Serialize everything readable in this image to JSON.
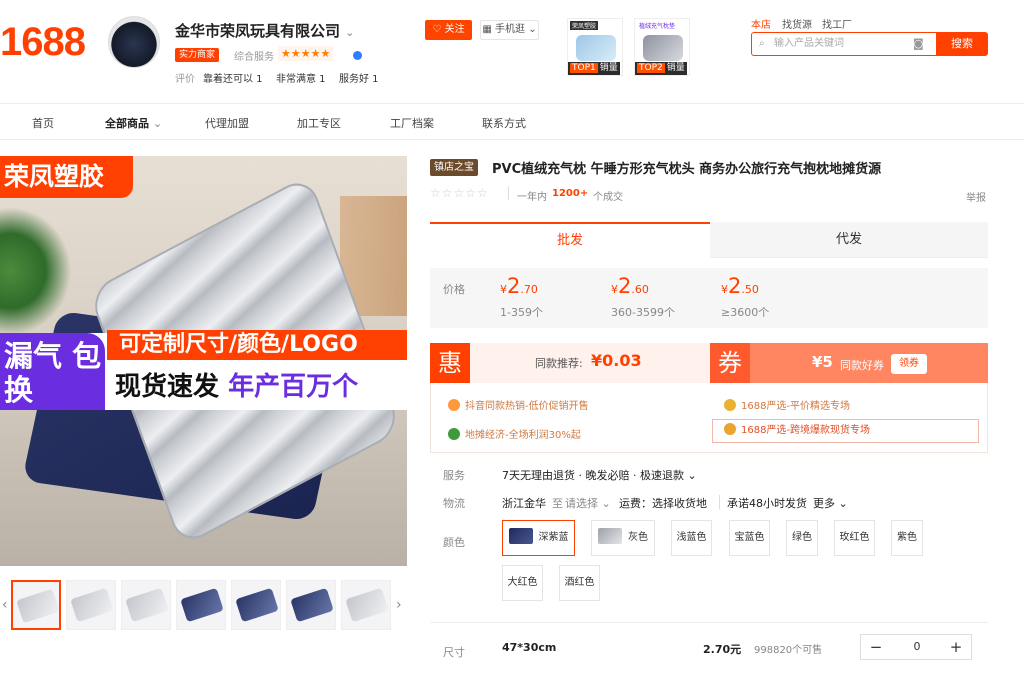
{
  "brand": {
    "logo": "1688"
  },
  "store": {
    "name": "金华市荣凤玩具有限公司",
    "strength_badge": "实力商家",
    "service_label": "综合服务",
    "stars": "★★★★★",
    "eval_label": "评价",
    "evals": [
      "靠着还可以 1",
      "非常满意 1",
      "服务好 1"
    ],
    "follow": "关注",
    "mobile": "手机逛"
  },
  "top_products": [
    {
      "badge": "TOP1",
      "label": "销量",
      "tag": "荣凤塑胶"
    },
    {
      "badge": "TOP2",
      "label": "销量",
      "tag": "植绒充气枕垫"
    }
  ],
  "top_nav": [
    "本店",
    "找货源",
    "找工厂"
  ],
  "search": {
    "placeholder": "输入产品关键词",
    "button": "搜索"
  },
  "nav": [
    "首页",
    "全部商品",
    "代理加盟",
    "加工专区",
    "工厂档案",
    "联系方式"
  ],
  "main_image": {
    "brand": "荣凤塑胶",
    "leak": "漏气 包换",
    "custom": "可定制尺寸/颜色/LOGO",
    "fast": "现货速发",
    "annual": "年产百万个"
  },
  "product": {
    "tag": "镇店之宝",
    "title": "PVC植绒充气枕 午睡方形充气枕头 商务办公旅行充气抱枕地摊货源",
    "stars": "☆☆☆☆☆",
    "deal_label": "一年内",
    "deal_count": "1200+",
    "deal_unit": "个成交",
    "report": "举报"
  },
  "tabs": [
    "批发",
    "代发"
  ],
  "prices": {
    "label": "价格",
    "tiers": [
      {
        "yen": "¥",
        "int": "2",
        "dec": ".70",
        "range": "1-359个"
      },
      {
        "yen": "¥",
        "int": "2",
        "dec": ".60",
        "range": "360-3599个"
      },
      {
        "yen": "¥",
        "int": "2",
        "dec": ".50",
        "range": "≥3600个"
      }
    ]
  },
  "promo": {
    "hui_icon": "惠",
    "hui_text": "同款推荐:",
    "hui_price": "¥0.03",
    "quan_icon": "券",
    "quan_amount": "¥5",
    "quan_text": "同款好券",
    "quan_button": "领券",
    "items": [
      "抖音同款热销-低价促销开售",
      "地摊经济-全场利润30%起",
      "1688严选-平价精选专场",
      "1688严选-跨境爆款现货专场"
    ]
  },
  "service": {
    "label": "服务",
    "text": "7天无理由退货 · 晚发必赔 · 极速退款 ⌄"
  },
  "logistics": {
    "label": "物流",
    "origin": "浙江金华",
    "to": "至",
    "choose": "请选择 ⌄",
    "freight": "运费：选择收货地",
    "promise": "承诺48小时发货",
    "more": "更多 ⌄"
  },
  "colors": {
    "label": "颜色",
    "options": [
      "深紫蓝",
      "灰色",
      "浅蓝色",
      "宝蓝色",
      "绿色",
      "玫红色",
      "紫色",
      "大红色",
      "酒红色"
    ]
  },
  "size": {
    "label": "尺寸",
    "value": "47*30cm",
    "price": "2.70元",
    "stock": "998820个可售",
    "qty": "0",
    "minus": "−",
    "plus": "+"
  }
}
